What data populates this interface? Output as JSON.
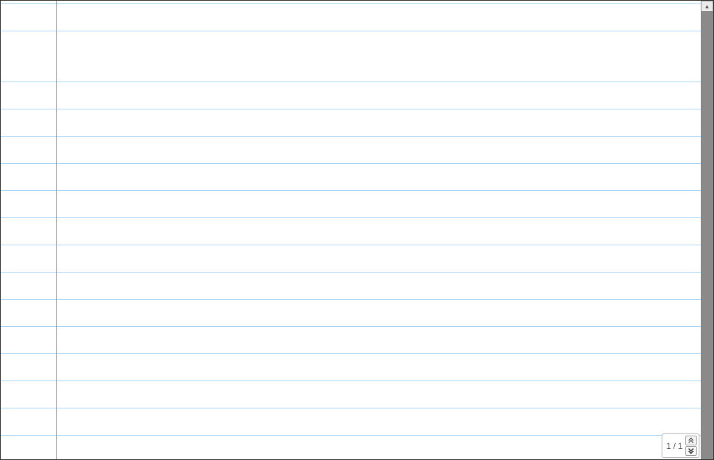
{
  "page": {
    "current": 1,
    "total": 1,
    "display": "1 / 1"
  }
}
